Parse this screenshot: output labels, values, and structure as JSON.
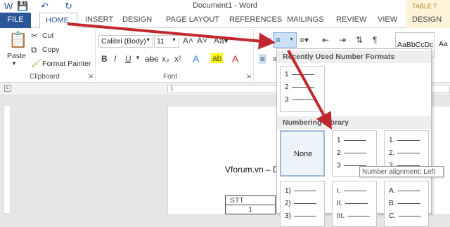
{
  "window": {
    "title": "Document1 - Word",
    "table_tools": "TABLE T"
  },
  "tabs": {
    "file": "FILE",
    "home": "HOME",
    "insert": "INSERT",
    "design": "DESIGN",
    "page_layout": "PAGE LAYOUT",
    "references": "REFERENCES",
    "mailings": "MAILINGS",
    "review": "REVIEW",
    "view": "VIEW",
    "design2": "DESIGN"
  },
  "clipboard": {
    "paste": "Paste",
    "cut": "Cut",
    "copy": "Copy",
    "format_painter": "Format Painter",
    "label": "Clipboard"
  },
  "font": {
    "name": "Calibri (Body)",
    "size": "11",
    "label": "Font"
  },
  "styles": {
    "sample": "AaBbCcDc",
    "sample2": "Aa"
  },
  "dropdown": {
    "recent_header": "Recently Used Number Formats",
    "library_header": "Numbering Library",
    "none_label": "None",
    "recent_rows": [
      "1",
      "2",
      "3"
    ],
    "lib1_rows": [
      "1",
      "2",
      "3"
    ],
    "lib2_rows": [
      "1.",
      "2.",
      "3."
    ],
    "row2_a": [
      "1)",
      "2)",
      "3)"
    ],
    "row2_b": [
      "I.",
      "II.",
      "III."
    ],
    "row2_c": [
      "A.",
      "B.",
      "C."
    ]
  },
  "tooltip": "Number alignment: Left",
  "document": {
    "text": "Vforum.vn – D",
    "table_header": "STT",
    "table_row": "1"
  },
  "ruler": {
    "mark": "1"
  },
  "colors": {
    "file_tab": "#2b579a",
    "arrow": "#c0282d"
  }
}
